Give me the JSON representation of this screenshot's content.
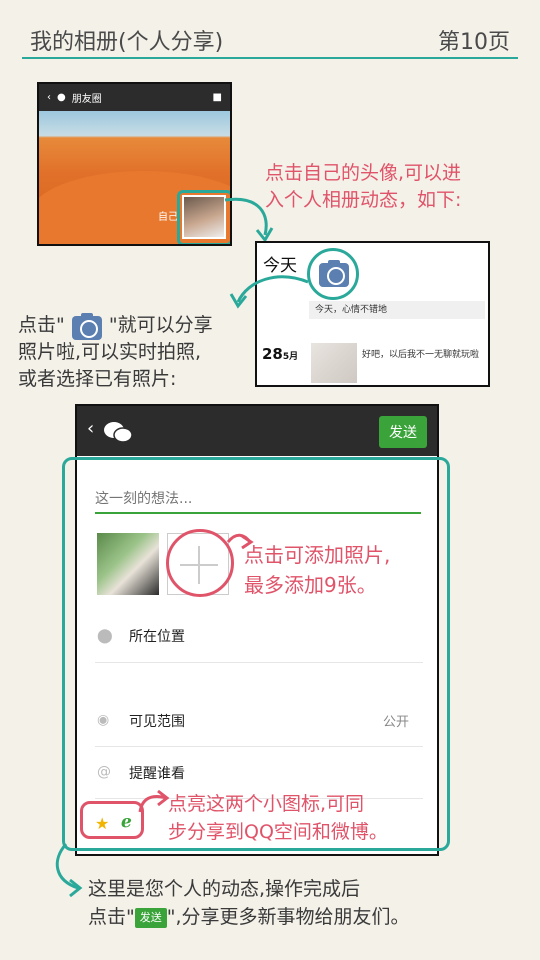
{
  "header": {
    "title": "我的相册(个人分享)",
    "page_number": "第10页"
  },
  "moments": {
    "title": "朋友圈",
    "self_label": "自己"
  },
  "notes": {
    "enter_album_line1": "点击自己的头像,可以进",
    "enter_album_line2": "入个人相册动态，如下:",
    "share_line1_a": "点击\"",
    "share_line1_b": "\"就可以分享",
    "share_line2": "照片啦,可以实时拍照,",
    "share_line3": "或者选择已有照片:",
    "add_photo_line1": "点击可添加照片,",
    "add_photo_line2": "最多添加9张。",
    "sync_line1": "点亮这两个小图标,可同",
    "sync_line2": "步分享到QQ空间和微博。",
    "bottom_line1": "这里是您个人的动态,操作完成后",
    "bottom_line2_a": "点击\"",
    "bottom_line2_chip": "发送",
    "bottom_line2_b": "\",分享更多新事物给朋友们。"
  },
  "album": {
    "today": "今天",
    "post1": "今天，心情不错地",
    "date_day": "28",
    "date_month": "5月",
    "post2": "好吧，以后我不一无聊就玩啦"
  },
  "compose": {
    "send_label": "发送",
    "placeholder": "这一刻的想法...",
    "location_label": "所在位置",
    "visibility_label": "可见范围",
    "visibility_value": "公开",
    "remind_label": "提醒谁看"
  },
  "colors": {
    "accent_teal": "#2aa99b",
    "note_pink": "#e0546a",
    "wechat_green": "#3aa43a"
  }
}
